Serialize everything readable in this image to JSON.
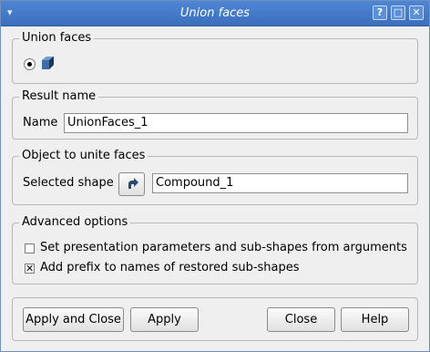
{
  "window": {
    "title": "Union faces"
  },
  "union_group": {
    "title": "Union faces",
    "option_icon": "box-shape-icon"
  },
  "result_group": {
    "title": "Result name",
    "name_label": "Name",
    "name_value": "UnionFaces_1"
  },
  "object_group": {
    "title": "Object to unite faces",
    "shape_label": "Selected shape",
    "shape_value": "Compound_1",
    "select_icon": "arrow-select-icon"
  },
  "advanced_group": {
    "title": "Advanced options",
    "opt1": {
      "label": "Set presentation parameters and sub-shapes from arguments",
      "checked": false
    },
    "opt2": {
      "label": "Add prefix to names of restored sub-shapes",
      "checked": true
    }
  },
  "buttons": {
    "apply_close": "Apply and Close",
    "apply": "Apply",
    "close": "Close",
    "help": "Help"
  }
}
